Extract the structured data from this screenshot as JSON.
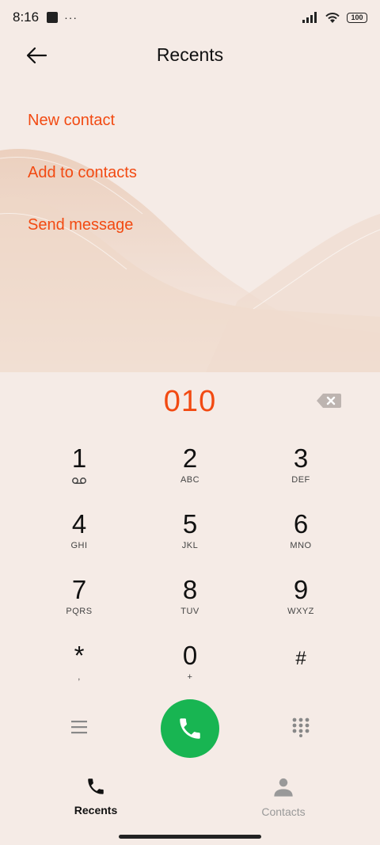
{
  "status_bar": {
    "time": "8:16",
    "dots": "···",
    "battery": "100"
  },
  "header": {
    "title": "Recents",
    "back_icon": "arrow-left-icon"
  },
  "menu": {
    "new_contact": "New contact",
    "add_to_contacts": "Add to contacts",
    "send_message": "Send message"
  },
  "dialer": {
    "number": "010",
    "keys": [
      {
        "digit": "1",
        "letters": ""
      },
      {
        "digit": "2",
        "letters": "ABC"
      },
      {
        "digit": "3",
        "letters": "DEF"
      },
      {
        "digit": "4",
        "letters": "GHI"
      },
      {
        "digit": "5",
        "letters": "JKL"
      },
      {
        "digit": "6",
        "letters": "MNO"
      },
      {
        "digit": "7",
        "letters": "PQRS"
      },
      {
        "digit": "8",
        "letters": "TUV"
      },
      {
        "digit": "9",
        "letters": "WXYZ"
      },
      {
        "digit": "*",
        "letters": ","
      },
      {
        "digit": "0",
        "letters": "+"
      },
      {
        "digit": "#",
        "letters": ""
      }
    ]
  },
  "tabs": {
    "recents": "Recents",
    "contacts": "Contacts"
  },
  "colors": {
    "accent": "#f24a12",
    "call_green": "#18b552",
    "background": "#f5ebe6"
  }
}
